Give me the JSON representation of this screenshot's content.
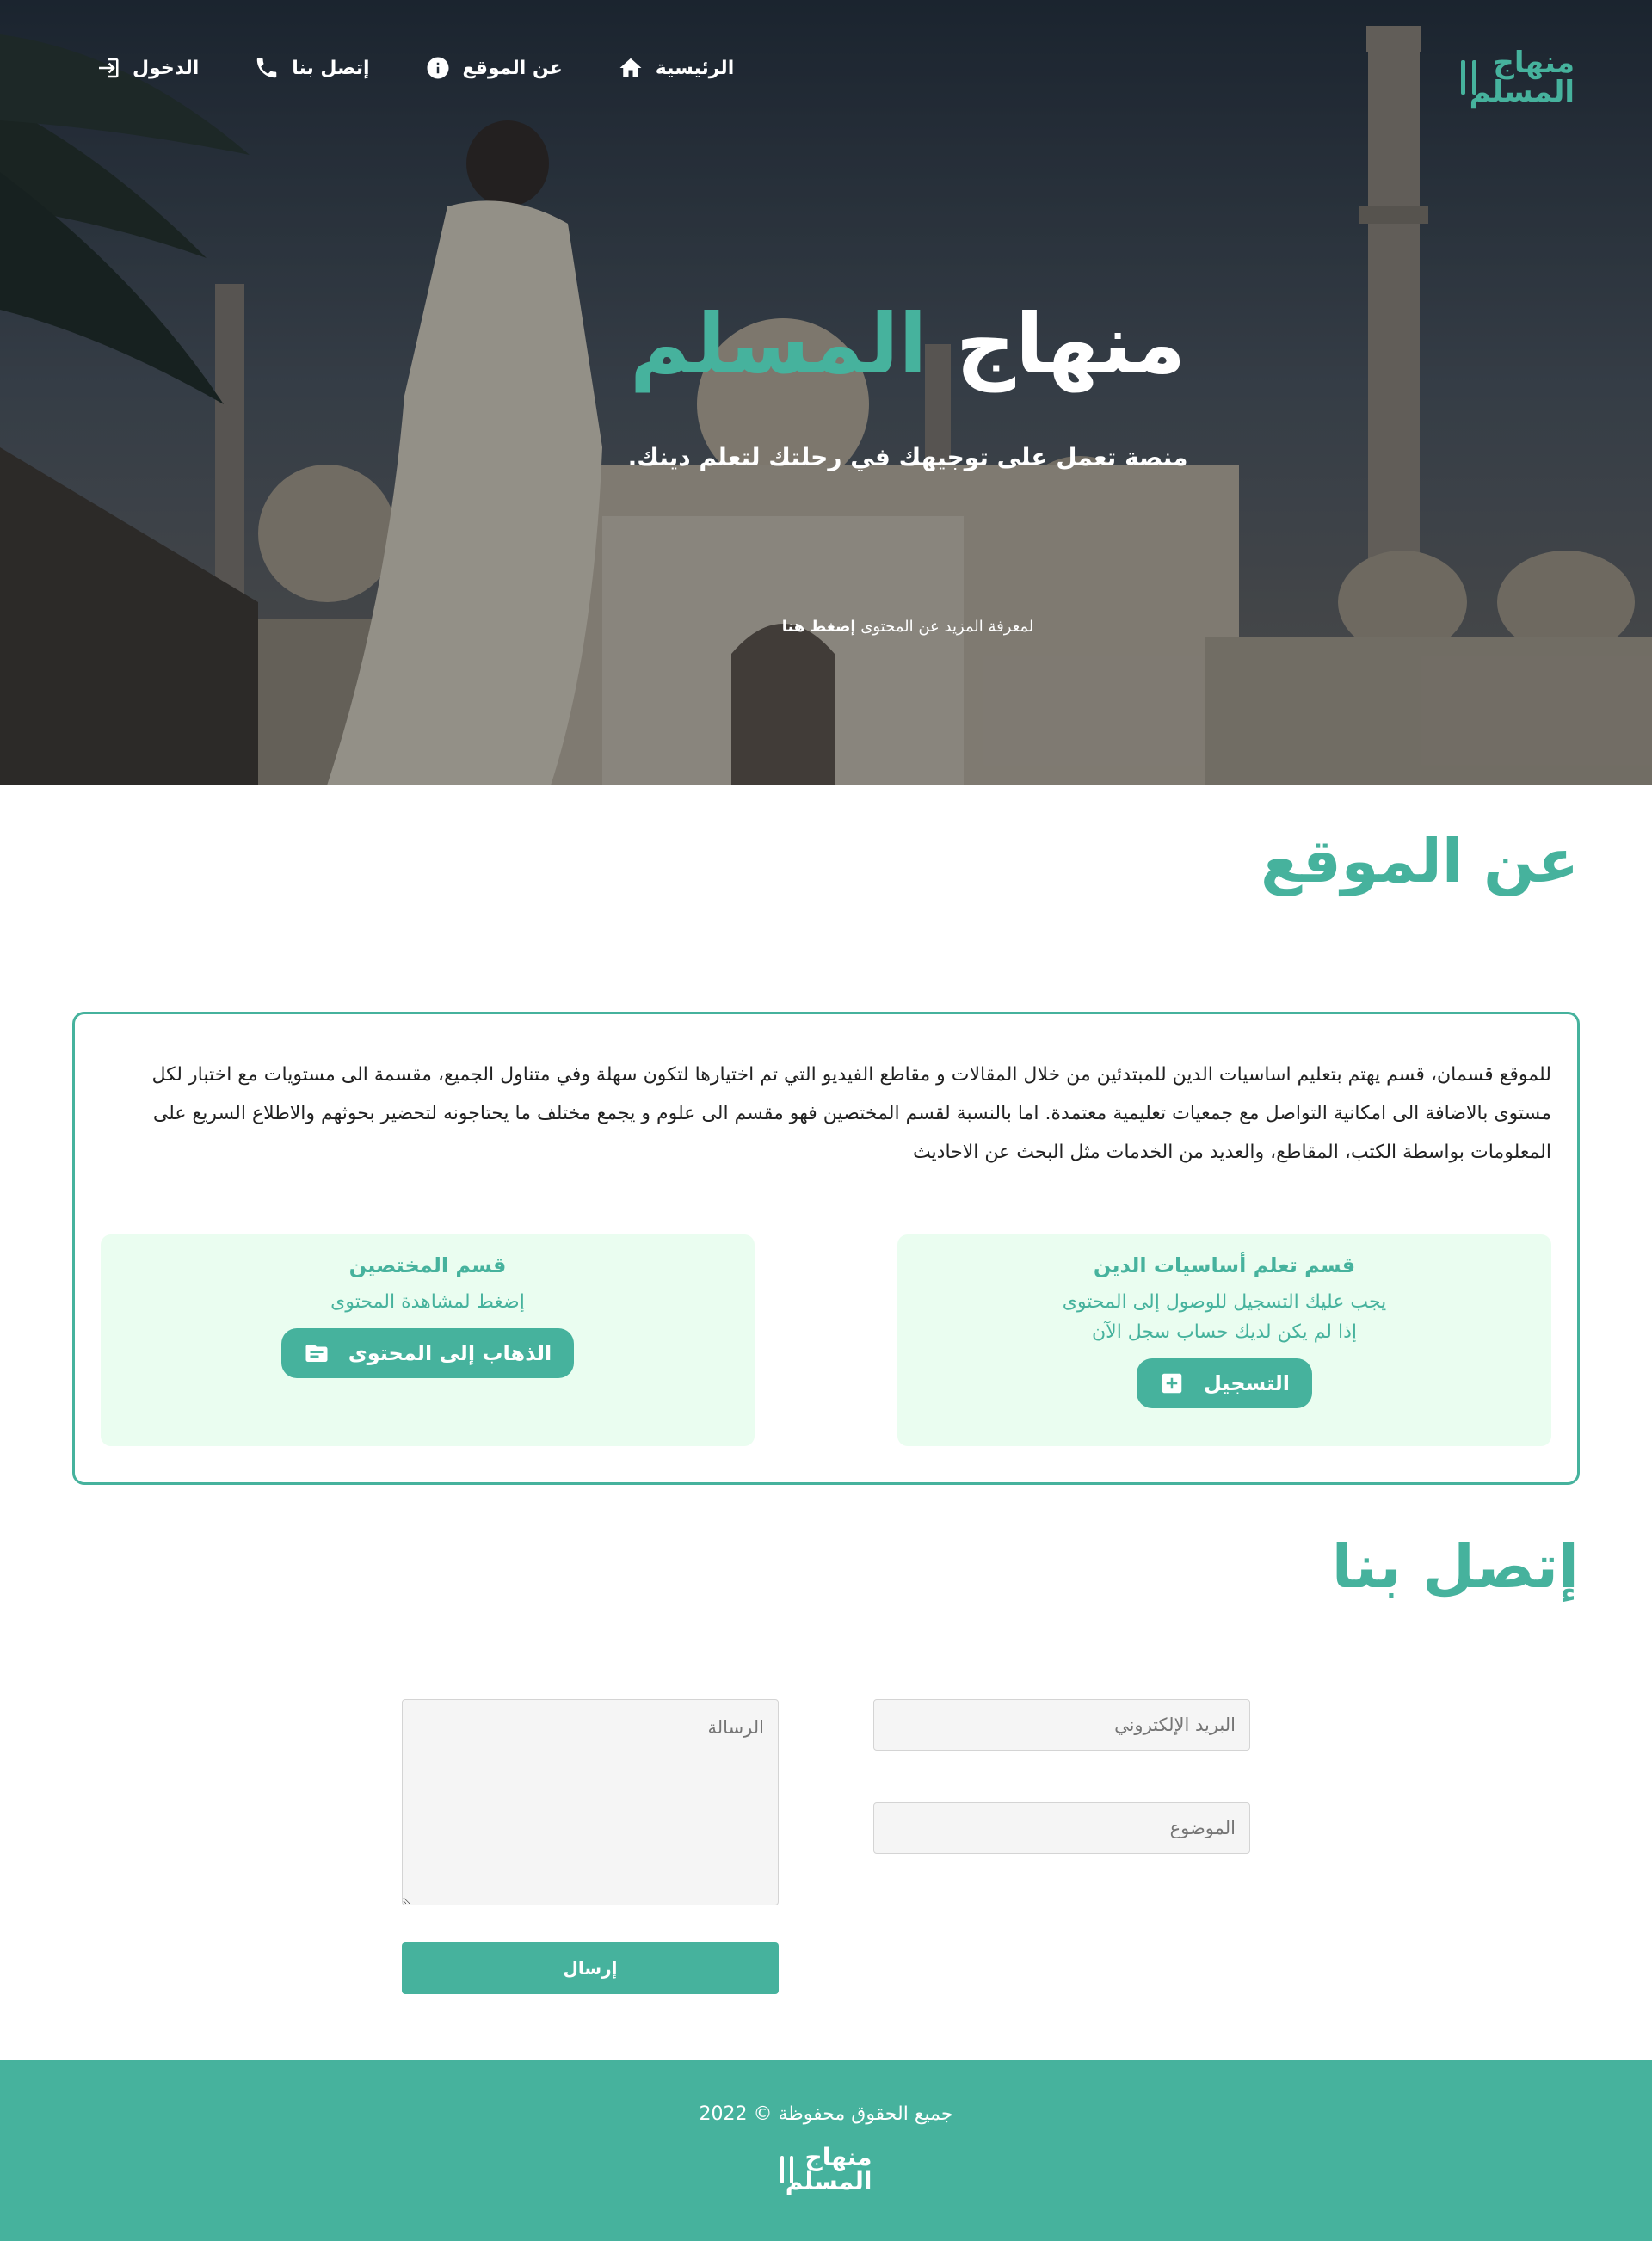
{
  "brand": {
    "logo_text": "منهاج المسلم",
    "accent_color": "#46b29d"
  },
  "nav": {
    "items": [
      {
        "label": "الرئيسية",
        "icon": "home-icon"
      },
      {
        "label": "عن الموقع",
        "icon": "info-icon"
      },
      {
        "label": "إتصل بنا",
        "icon": "phone-icon"
      },
      {
        "label": "الدخول",
        "icon": "login-icon"
      }
    ]
  },
  "hero": {
    "title_white": "منهاج",
    "title_green": "المسلم",
    "subtitle": "منصة تعمل على توجيهك في رحلتك لتعلم دينك.",
    "more_text": "لمعرفة المزيد عن المحتوى",
    "more_link": "إضغط هنا"
  },
  "about": {
    "title": "عن الموقع",
    "text": "للموقع قسمان، قسم يهتم بتعليم اساسيات الدين للمبتدئين من خلال المقالات و مقاطع الفيديو التي تم اختيارها لتكون سهلة وفي متناول الجميع، مقسمة الى مستويات مع اختبار لكل مستوى بالاضافة الى امكانية التواصل مع جمعيات تعليمية معتمدة. اما بالنسبة لقسم المختصين فهو مقسم الى علوم و يجمع مختلف ما يحتاجونه لتحضير بحوثهم والاطلاع السريع على المعلومات بواسطة الكتب، المقاطع، والعديد من الخدمات مثل البحث عن الاحاديث",
    "basics_card": {
      "title": "قسم تعلم أساسيات الدين",
      "line1": "يجب عليك التسجيل للوصول إلى المحتوى",
      "line2": "إذا لم يكن لديك حساب سجل الآن",
      "button": "التسجيل"
    },
    "experts_card": {
      "title": "قسم المختصين",
      "line1": "إضغط لمشاهدة المحتوى",
      "button": "الذهاب إلى المحتوى"
    }
  },
  "contact": {
    "title": "إتصل بنا",
    "email_placeholder": "البريد الإلكتروني",
    "subject_placeholder": "الموضوع",
    "message_placeholder": "الرسالة",
    "submit": "إرسال"
  },
  "footer": {
    "copyright": "جميع الحقوق محفوظة © 2022",
    "logo_text": "منهاج المسلم"
  }
}
